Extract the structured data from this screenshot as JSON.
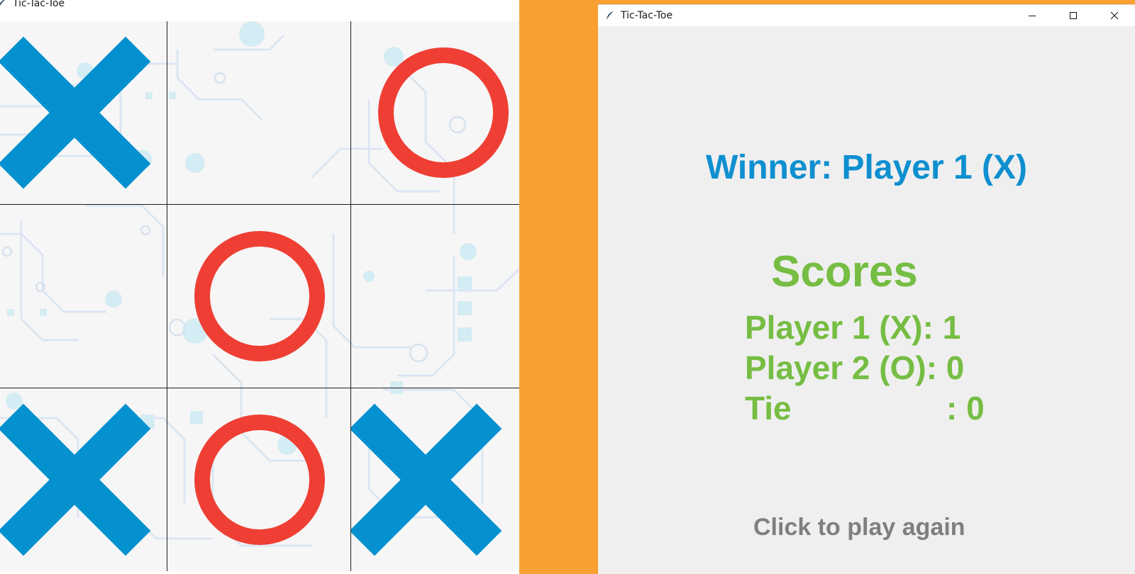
{
  "left_window": {
    "title": "Tic-Tac-Toe",
    "board": [
      {
        "mark": "X"
      },
      {
        "mark": ""
      },
      {
        "mark": "O"
      },
      {
        "mark": ""
      },
      {
        "mark": "O"
      },
      {
        "mark": ""
      },
      {
        "mark": "X"
      },
      {
        "mark": "O"
      },
      {
        "mark": "X"
      }
    ]
  },
  "right_window": {
    "title": "Tic-Tac-Toe",
    "winner_text": "Winner: Player 1 (X)",
    "scores_title": "Scores",
    "scores": [
      {
        "label": "Player 1 (X)",
        "value": "1"
      },
      {
        "label": "Player 2 (O)",
        "value": "0"
      }
    ],
    "tie": {
      "label": "Tie",
      "value": ": 0"
    },
    "play_again": "Click to play again"
  },
  "colors": {
    "x_mark": "#0591cf",
    "o_mark": "#ef3f34",
    "winner_text": "#0e8fd0",
    "scores_text": "#76bd43",
    "play_again_text": "#7f7f7f",
    "background": "#f9a033"
  },
  "icons": {
    "app": "feather-icon",
    "minimize": "minimize-icon",
    "maximize": "maximize-icon",
    "close": "close-icon"
  }
}
